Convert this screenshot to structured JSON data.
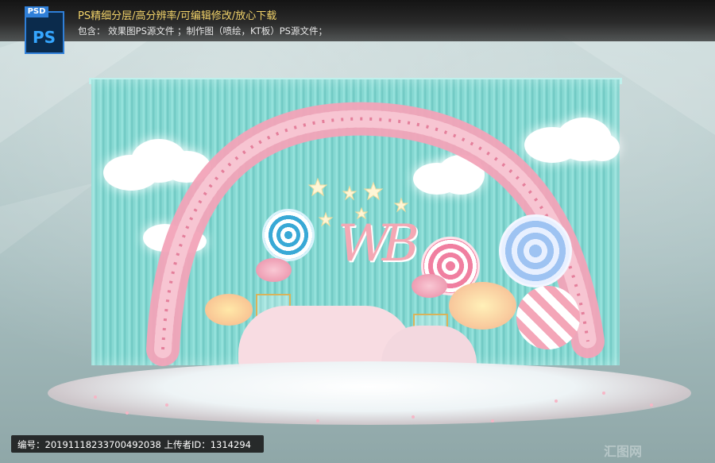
{
  "header": {
    "line1": "PS精细分层/高分辨率/可编辑修改/放心下载",
    "line2": "包含：  效果图PS源文件  ；制作图（喷绘，KT板）PS源文件；"
  },
  "psd_badge": {
    "tab": "PSD",
    "label": "PS"
  },
  "monogram": "WB",
  "footer": {
    "id_text": "编号：20191118233700492038 上传者ID：1314294"
  },
  "watermark": "汇图网",
  "colors": {
    "backdrop": "#8ddcd6",
    "arch_pink": "#f2a3b8",
    "lolli_blue": "#a8c8f0",
    "lolli_pink": "#f4a6b8"
  }
}
